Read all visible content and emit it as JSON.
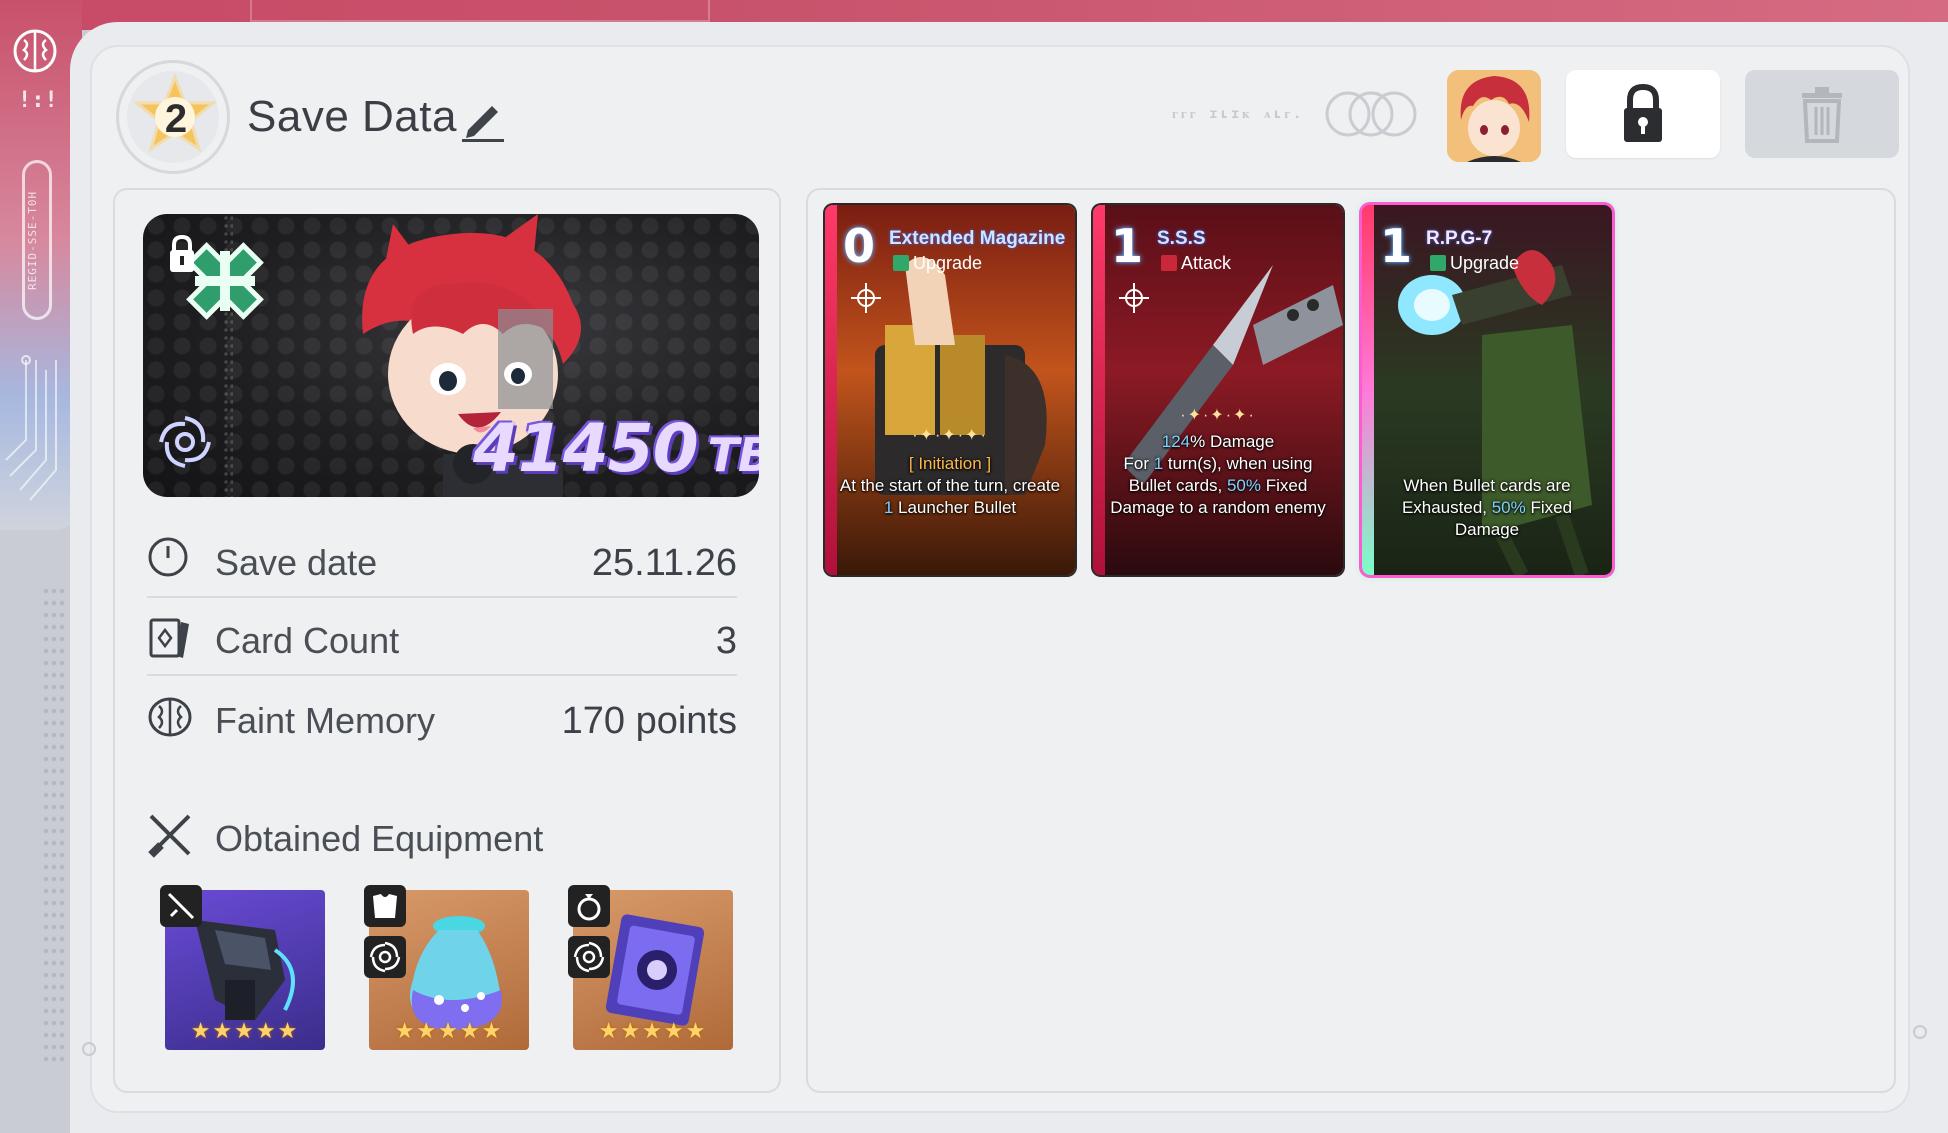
{
  "header": {
    "level": "2",
    "title": "Save Data",
    "faint_text": "ᴦᴦᴦ ɪʟɪᴋ ᴀʟᴦ."
  },
  "rail": {
    "pill_text": "REGID-SSE-T0H"
  },
  "banner": {
    "tb_value": "41450",
    "tb_unit": "TB"
  },
  "stats": [
    {
      "label": "Save date",
      "value": "25.11.26"
    },
    {
      "label": "Card Count",
      "value": "3"
    },
    {
      "label": "Faint Memory",
      "value": "170 points"
    }
  ],
  "equipment": {
    "title": "Obtained Equipment",
    "items": [
      {
        "name": "gauntlet-weapon",
        "slot": "weapon",
        "stars": "★★★★★"
      },
      {
        "name": "potion-armor",
        "slot": "armor",
        "stars": "★★★★★"
      },
      {
        "name": "chip-accessory",
        "slot": "ring",
        "stars": "★★★★★"
      }
    ]
  },
  "cards": [
    {
      "cost": "0",
      "name": "Extended Magazine",
      "type": "Upgrade",
      "tag": "[ Initiation ]",
      "desc_pre": "At the start of the turn, create ",
      "desc_hl": "1",
      "desc_post": " Launcher Bullet"
    },
    {
      "cost": "1",
      "name": "S.S.S",
      "type": "Attack",
      "line1_hl": "124",
      "line1_post": "% Damage",
      "line2_pre": "For ",
      "line2_hl": "1",
      "line2_post": " turn(s), when using Bullet cards, ",
      "line2_hl2": "50%",
      "line2_post2": " Fixed Damage to a random enemy"
    },
    {
      "cost": "1",
      "name": "R.P.G-7",
      "type": "Upgrade",
      "desc_pre": "When Bullet cards are Exhausted, ",
      "desc_hl": "50%",
      "desc_post": " Fixed Damage"
    }
  ],
  "colors": {
    "accent_pink": "#c84a66",
    "panel_bg": "#eef0f2",
    "text_dark": "#3b3f45"
  }
}
